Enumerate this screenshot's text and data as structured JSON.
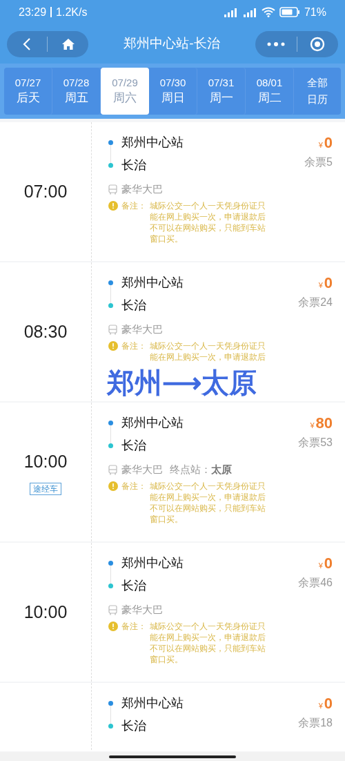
{
  "status_bar": {
    "time": "23:29",
    "speed": "1.2K/s",
    "battery": "71%"
  },
  "header": {
    "title": "郑州中心站-长治"
  },
  "date_tabs": [
    {
      "date": "07/27",
      "day": "后天",
      "selected": false
    },
    {
      "date": "07/28",
      "day": "周五",
      "selected": false
    },
    {
      "date": "07/29",
      "day": "周六",
      "selected": true
    },
    {
      "date": "07/30",
      "day": "周日",
      "selected": false
    },
    {
      "date": "07/31",
      "day": "周一",
      "selected": false
    },
    {
      "date": "08/01",
      "day": "周二",
      "selected": false
    }
  ],
  "calendar_button": {
    "label": "全部日历"
  },
  "trips": [
    {
      "time": "07:00",
      "from": "郑州中心站",
      "to": "长治",
      "currency": "¥",
      "price": "0",
      "remaining": "余票5",
      "bus_type": "豪华大巴",
      "note_label": "备注：",
      "note": "城际公交一个人一天凭身份证只能在网上购买一次，申请退款后不可以在网站购买，只能到车站窗口买。"
    },
    {
      "time": "08:30",
      "from": "郑州中心站",
      "to": "长治",
      "currency": "¥",
      "price": "0",
      "remaining": "余票24",
      "bus_type": "豪华大巴",
      "note_label": "备注：",
      "note": "城际公交一个人一天凭身份证只能在网上购买一次，申请退款后"
    },
    {
      "time": "10:00",
      "tag": "途经车",
      "from": "郑州中心站",
      "to": "长治",
      "currency": "¥",
      "price": "80",
      "remaining": "余票53",
      "bus_type": "豪华大巴",
      "terminal_label": "终点站：",
      "terminal": "太原",
      "note_label": "备注：",
      "note": "城际公交一个人一天凭身份证只能在网上购买一次，申请退款后不可以在网站购买，只能到车站窗口买。"
    },
    {
      "time": "10:00",
      "from": "郑州中心站",
      "to": "长治",
      "currency": "¥",
      "price": "0",
      "remaining": "余票46",
      "bus_type": "豪华大巴",
      "note_label": "备注：",
      "note": "城际公交一个人一天凭身份证只能在网上购买一次，申请退款后不可以在网站购买，只能到车站窗口买。"
    },
    {
      "from": "郑州中心站",
      "to": "长治",
      "currency": "¥",
      "price": "0",
      "remaining": "余票18"
    }
  ],
  "annotation": {
    "text": "郑州⟶太原"
  }
}
